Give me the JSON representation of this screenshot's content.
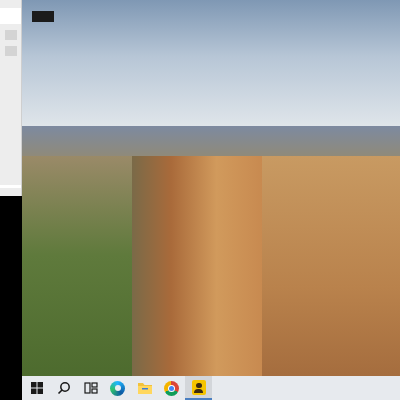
{
  "desktop": {
    "wallpaper": "photo"
  },
  "taskbar": {
    "items": [
      {
        "kind": "start",
        "selected": false
      },
      {
        "kind": "search",
        "selected": false
      },
      {
        "kind": "task-view",
        "selected": false
      },
      {
        "kind": "edge",
        "selected": false
      },
      {
        "kind": "file-explorer",
        "selected": false
      },
      {
        "kind": "chrome",
        "selected": false
      },
      {
        "kind": "app",
        "selected": true
      }
    ]
  }
}
